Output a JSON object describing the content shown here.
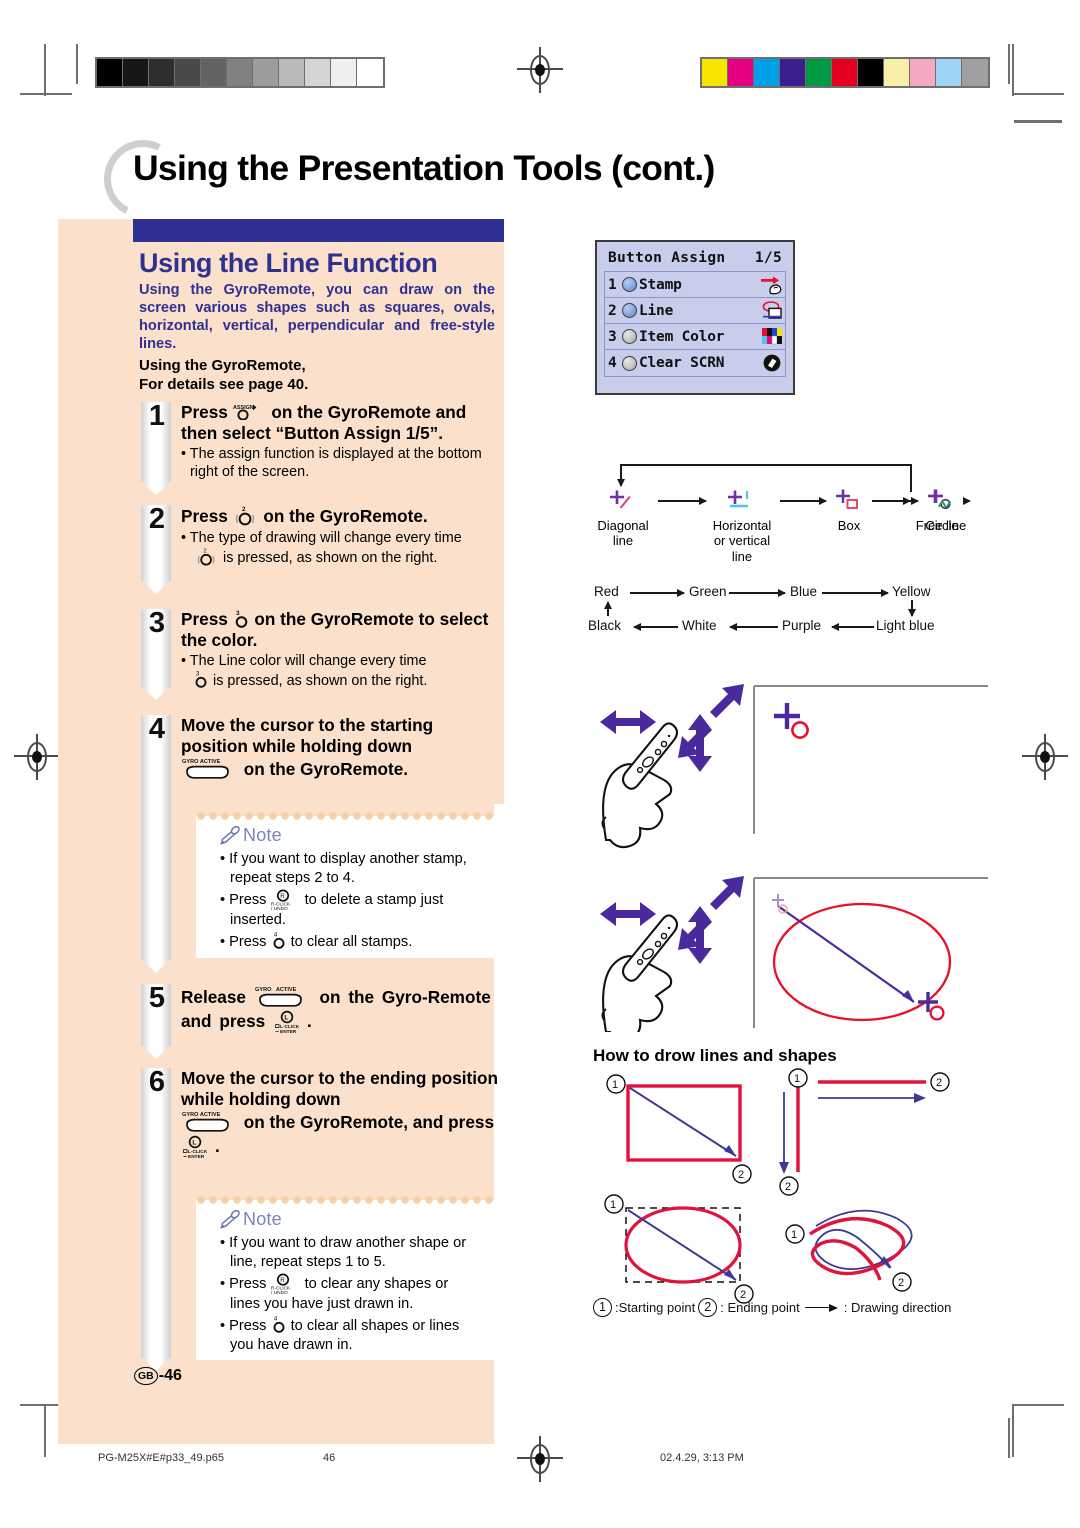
{
  "header": {
    "title": "Using the Presentation Tools (cont.)"
  },
  "section": {
    "title": "Using the Line Function",
    "lead": "Using the GyroRemote, you can draw on the screen various shapes such as squares, ovals, horizontal, vertical, perpendicular and free-style lines.",
    "subtitle_line1": "Using the GyroRemote,",
    "subtitle_line2": "For details see page 40."
  },
  "steps": [
    {
      "number": "1",
      "text_parts": [
        "Press",
        "on the GyroRemote and then select “Button Assign 1/5”."
      ],
      "button_label": "ASSIGN",
      "bullets": [
        "• The assign function is displayed at the bottom right of the screen."
      ]
    },
    {
      "number": "2",
      "text_parts": [
        "Press",
        "on the GyroRemote."
      ],
      "button_label": "2",
      "bullets": [
        "• The type of drawing will change every time",
        "is pressed, as shown on the right."
      ]
    },
    {
      "number": "3",
      "text_parts": [
        "Press",
        "on the GyroRemote to select the color."
      ],
      "button_label": "3",
      "bullets": [
        "• The Line color will change every time",
        "is pressed, as shown on the right."
      ]
    },
    {
      "number": "4",
      "text_parts": [
        "Move the cursor to the starting position while holding down",
        "on the GyroRemote."
      ],
      "button_label": "GYRO ACTIVE",
      "bullets": []
    },
    {
      "number": "5",
      "text_parts": [
        "Release",
        "on the Gyro-Remote and press",
        "."
      ],
      "button_label": "GYRO ACTIVE",
      "button_label2": "L-CLICK / ENTER",
      "bullets": []
    },
    {
      "number": "6",
      "text_parts": [
        "Move the cursor to the ending position while holding down",
        "on the GyroRemote, and press",
        "."
      ],
      "button_label": "GYRO ACTIVE",
      "button_label2": "L-CLICK / ENTER",
      "bullets": []
    }
  ],
  "notes": [
    {
      "label": "Note",
      "items": [
        "• If you want to display another stamp, repeat steps 2 to 4.",
        "• Press  to delete a stamp just inserted.",
        "• Press  to clear all stamps."
      ]
    },
    {
      "label": "Note",
      "items": [
        "• If you want to draw another shape or line, repeat steps 1 to 5.",
        "• Press  to clear any shapes or lines you have just drawn in.",
        "• Press  to clear all shapes or lines you have drawn in."
      ]
    }
  ],
  "page_badge": {
    "region": "GB",
    "number": "-46"
  },
  "osd": {
    "title": "Button Assign",
    "page": "1/5",
    "rows": [
      {
        "index": "1",
        "label": "Stamp",
        "state": "on",
        "icon": "stamp-icon"
      },
      {
        "index": "2",
        "label": "Line",
        "state": "on",
        "icon": "line-icon"
      },
      {
        "index": "3",
        "label": "Item Color",
        "state": "off",
        "icon": "color-swatch-icon"
      },
      {
        "index": "4",
        "label": "Clear SCRN",
        "state": "off",
        "icon": "eraser-icon"
      }
    ]
  },
  "draw_types": {
    "items": [
      {
        "label": "Diagonal line",
        "icon": "diagonal-line-icon",
        "accent": "#e0407e"
      },
      {
        "label": "Horizontal or vertical line",
        "icon": "horizontal-vertical-line-icon",
        "accent": "#4ec3f0"
      },
      {
        "label": "Box",
        "icon": "box-icon",
        "accent": "#e8384f"
      },
      {
        "label": "Circle",
        "icon": "circle-icon",
        "accent": "#3b2f8f"
      },
      {
        "label": "Free line",
        "icon": "free-line-icon",
        "accent": "#17a24a"
      }
    ],
    "cursor_color": "#6b32a8"
  },
  "color_cycle": {
    "top": [
      "Red",
      "Green",
      "Blue",
      "Yellow"
    ],
    "bottom": [
      "Black",
      "White",
      "Purple",
      "Light blue"
    ]
  },
  "howto": {
    "title": "How to drow lines and shapes",
    "start_marker": "1",
    "end_marker": "2",
    "legend_start": ":Starting point",
    "legend_end": ": Ending point",
    "legend_dir": ": Drawing direction",
    "shape_color": "#e1123c",
    "direction_color": "#3b3b93"
  },
  "footer": {
    "file": "PG-M25X#E#p33_49.p65",
    "page": "46",
    "timestamp": "02.4.29, 3:13 PM"
  },
  "calibration": {
    "grayscale": [
      "#000000",
      "#171717",
      "#2e2e2e",
      "#494949",
      "#636363",
      "#818181",
      "#9c9c9c",
      "#b9b9b9",
      "#d5d5d5",
      "#efefef",
      "#ffffff"
    ],
    "colors": [
      "#f5e400",
      "#e4007f",
      "#00a0e9",
      "#3b1f8f",
      "#009944",
      "#e60020",
      "#000000",
      "#f8f0a8",
      "#f5a8c0",
      "#9fd4f5",
      "#a0a0a0"
    ]
  }
}
